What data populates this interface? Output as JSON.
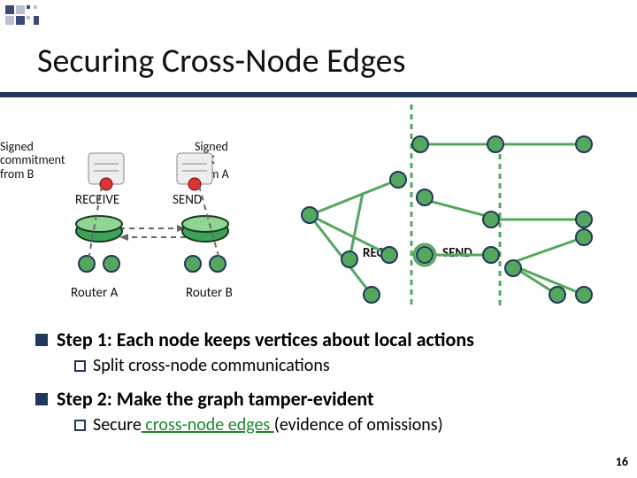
{
  "title": "Securing Cross-Node Edges",
  "labels": {
    "signed_commitment": "Signed\ncommitment\nfrom B",
    "signed_ack": "Signed\nACK\nfrom A",
    "receive": "RECEIVE",
    "send_top": "SEND",
    "router_a": "Router A",
    "router_b": "Router B",
    "recv_mid": "RECV",
    "send_mid": "SEND"
  },
  "steps": {
    "s1": "Step 1: Each node keeps vertices about local actions",
    "s1_sub_prefix": "Split",
    "s1_sub_rest": " cross-node communications",
    "s2": "Step 2: Make the graph tamper-evident",
    "s2_sub_prefix": "Secure",
    "s2_sub_link": " cross-node edges ",
    "s2_sub_paren": "(evidence of omissions)"
  },
  "pagenum": "16"
}
